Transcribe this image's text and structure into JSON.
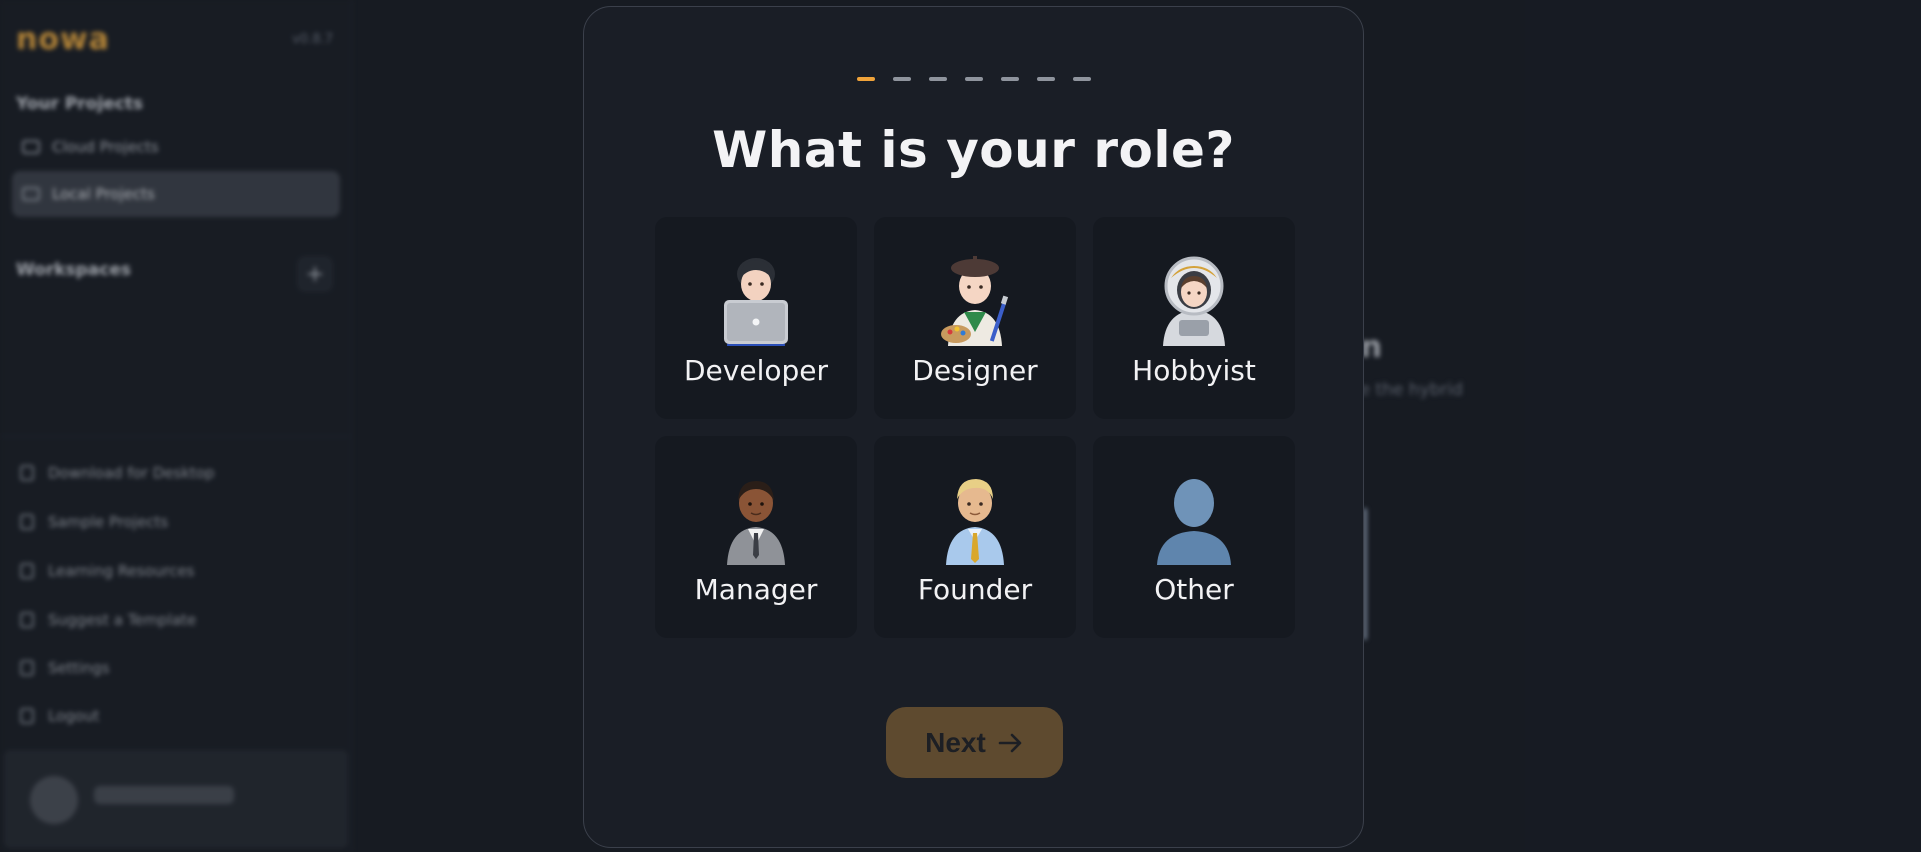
{
  "background": {
    "logo": "nowa",
    "version": "v0.8.7",
    "sidebar": {
      "projects_heading": "Your Projects",
      "items": [
        {
          "label": "Cloud Projects",
          "active": false
        },
        {
          "label": "Local Projects",
          "active": true
        }
      ],
      "workspaces_heading": "Workspaces",
      "bottom_items": [
        {
          "label": "Download for Desktop"
        },
        {
          "label": "Sample Projects"
        },
        {
          "label": "Learning Resources"
        },
        {
          "label": "Suggest a Template"
        },
        {
          "label": "Settings"
        },
        {
          "label": "Logout"
        }
      ]
    },
    "main": {
      "heading": "on",
      "subtext": "use the hybrid"
    }
  },
  "modal": {
    "steps_total": 7,
    "current_step": 1,
    "title": "What is your role?",
    "roles": [
      {
        "label": "Developer",
        "icon": "developer-icon"
      },
      {
        "label": "Designer",
        "icon": "designer-icon"
      },
      {
        "label": "Hobbyist",
        "icon": "astronaut-icon"
      },
      {
        "label": "Manager",
        "icon": "manager-icon"
      },
      {
        "label": "Founder",
        "icon": "founder-icon"
      },
      {
        "label": "Other",
        "icon": "person-silhouette-icon"
      }
    ],
    "next_label": "Next",
    "colors": {
      "accent": "#f0a33a",
      "next_button": "#5e4a2f",
      "card": "#151920"
    }
  }
}
